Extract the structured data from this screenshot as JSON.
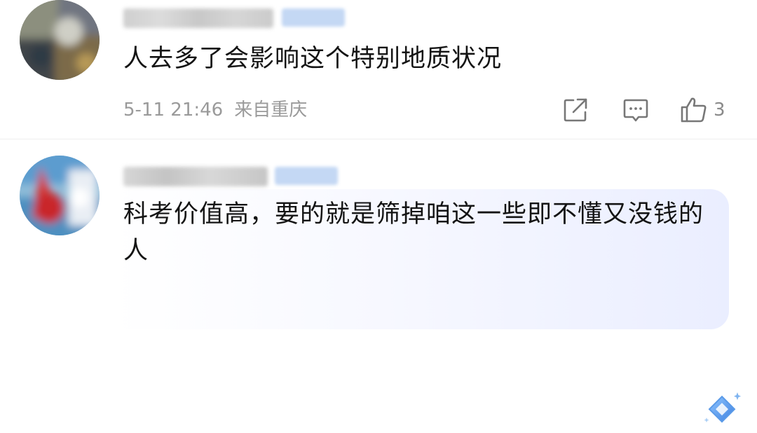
{
  "comments": [
    {
      "text": "人去多了会影响这个特别地质状况",
      "date": "5-11 21:46",
      "location": "来自重庆",
      "like_count": "3"
    },
    {
      "text": "科考价值高，要的就是筛掉咱这一些即不懂又没钱的人"
    }
  ],
  "icons": {
    "share": "share-icon",
    "reply": "comment-icon",
    "like": "thumbs-up-icon",
    "ai": "ai-sparkle-diamond-icon"
  },
  "colors": {
    "text": "#141414",
    "meta": "#9a9a9a",
    "icon": "#777777",
    "vip_badge": "#c4d8f4",
    "ai_accent": "#4a90e2"
  }
}
